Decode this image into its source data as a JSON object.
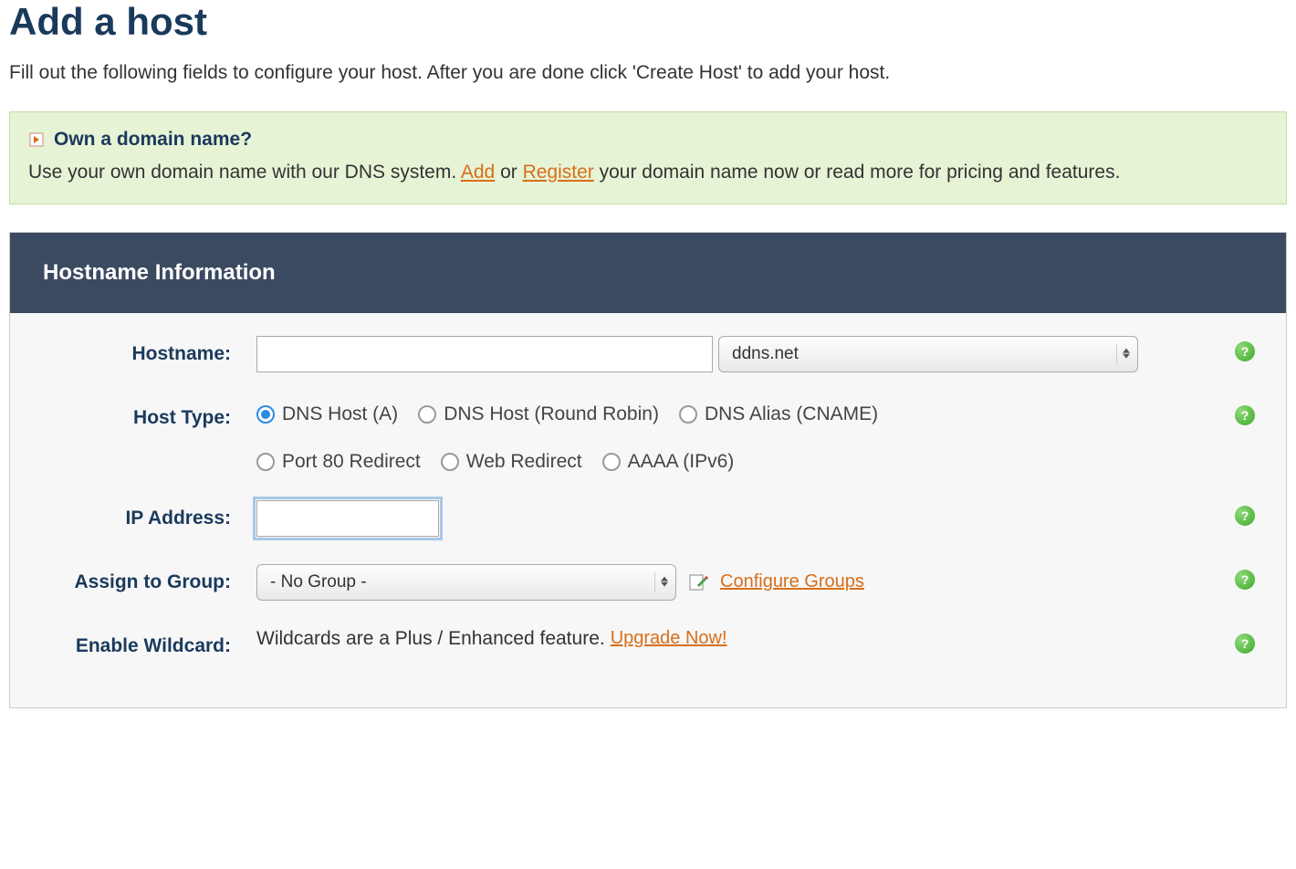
{
  "page": {
    "title": "Add a host",
    "description": "Fill out the following fields to configure your host. After you are done click 'Create Host' to add your host."
  },
  "notice": {
    "title": "Own a domain name?",
    "body_prefix": "Use your own domain name with our DNS system. ",
    "add_link": "Add",
    "or_text": " or ",
    "register_link": "Register",
    "body_suffix": " your domain name now or read more for pricing and features."
  },
  "panel": {
    "header": "Hostname Information"
  },
  "form": {
    "hostname": {
      "label": "Hostname:",
      "value": "",
      "domain_selected": "ddns.net"
    },
    "hosttype": {
      "label": "Host Type:",
      "options": {
        "dns_a": "DNS Host (A)",
        "dns_rr": "DNS Host (Round Robin)",
        "cname": "DNS Alias (CNAME)",
        "port80": "Port 80 Redirect",
        "webred": "Web Redirect",
        "aaaa": "AAAA (IPv6)"
      },
      "selected": "dns_a"
    },
    "ip": {
      "label": "IP Address:",
      "value": ""
    },
    "group": {
      "label": "Assign to Group:",
      "selected": "- No Group -",
      "configure_link": "Configure Groups"
    },
    "wildcard": {
      "label": "Enable Wildcard:",
      "text_prefix": "Wildcards are a Plus / Enhanced feature. ",
      "upgrade_link": "Upgrade Now!"
    }
  }
}
